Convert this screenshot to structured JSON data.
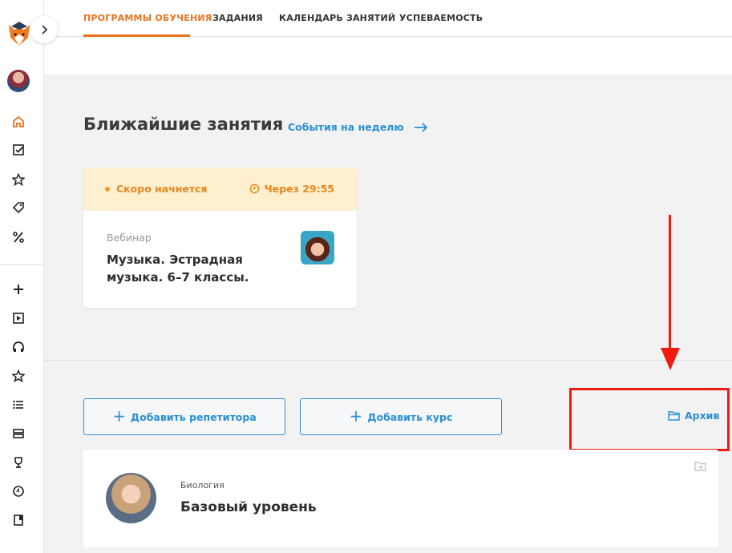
{
  "nav": {
    "tabs": [
      {
        "label": "ПРОГРАММЫ ОБУЧЕНИЯ",
        "active": true
      },
      {
        "label": "ЗАДАНИЯ",
        "active": false
      },
      {
        "label": "КАЛЕНДАРЬ ЗАНЯТИЙ",
        "active": false
      },
      {
        "label": "УСПЕВАЕМОСТЬ",
        "active": false
      }
    ]
  },
  "sidebar": {
    "icons": [
      "home-icon",
      "tasks-check-icon",
      "star-icon",
      "tag-icon",
      "percent-icon",
      "plus-icon",
      "play-icon",
      "headphones-icon",
      "star-outline-icon",
      "list-icon",
      "layers-icon",
      "trophy-icon",
      "clock-icon",
      "book-icon"
    ]
  },
  "upcoming": {
    "title": "Ближайшие занятия",
    "week_link": "События на неделю"
  },
  "lesson": {
    "status": "Скоро начнется",
    "timer": "Через 29:55",
    "type": "Вебинар",
    "title": "Музыка. Эстрадная музыка. 6–7 классы."
  },
  "actions": {
    "add_tutor": "Добавить репетитора",
    "add_course": "Добавить курс",
    "archive": "Архив"
  },
  "course": {
    "subject": "Биология",
    "title": "Базовый уровень"
  },
  "colors": {
    "accent": "#e8731e",
    "link": "#2a8fd6",
    "highlight": "#ee1b0e",
    "card_head": "#fef0cf"
  }
}
